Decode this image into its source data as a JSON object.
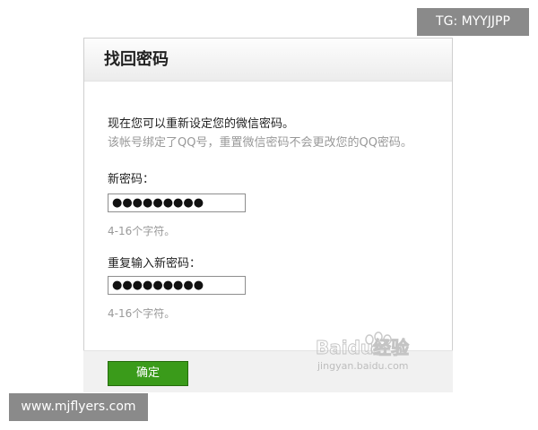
{
  "badges": {
    "telegram": "TG: MYYJJPP",
    "site": "www.mjflyers.com"
  },
  "panel": {
    "title": "找回密码",
    "intro": "现在您可以重新设定您的微信密码。",
    "note": "该帐号绑定了QQ号，重置微信密码不会更改您的QQ密码。",
    "new_password": {
      "label": "新密码：",
      "value": "●●●●●●●●●",
      "hint": "4-16个字符。"
    },
    "repeat_password": {
      "label": "重复输入新密码：",
      "value": "●●●●●●●●●",
      "hint": "4-16个字符。"
    },
    "confirm_label": "确定"
  },
  "watermark": {
    "brand": "Baidu经验",
    "url": "jingyan.baidu.com"
  },
  "colors": {
    "button": "#3a9b1a",
    "hint_text": "#999999"
  }
}
